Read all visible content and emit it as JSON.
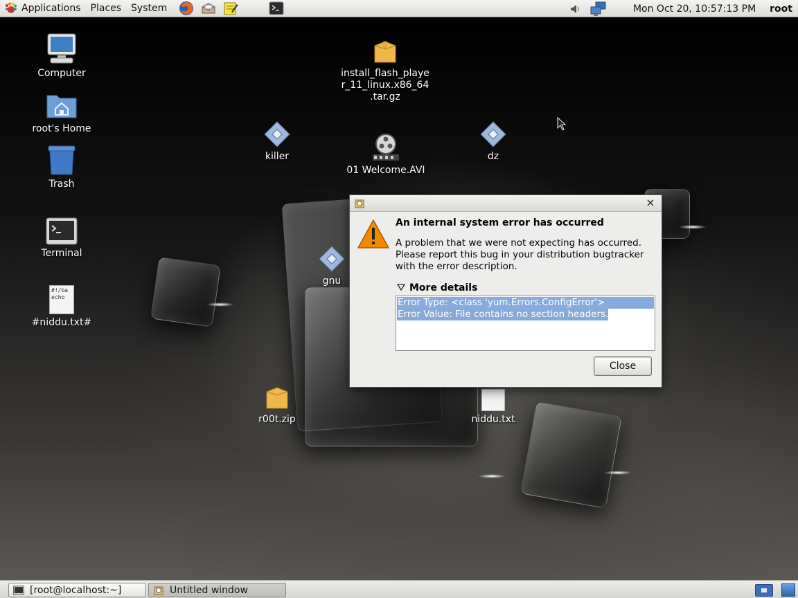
{
  "top_panel": {
    "menus": {
      "applications": "Applications",
      "places": "Places",
      "system": "System"
    },
    "clock": "Mon Oct 20, 10:57:13 PM",
    "user": "root"
  },
  "desktop_icons": {
    "computer": "Computer",
    "home": "root's Home",
    "trash": "Trash",
    "terminal": "Terminal",
    "niddu_backup": "#niddu.txt#",
    "flash_player": "install_flash_player_11_linux.x86_64.tar.gz",
    "killer": "killer",
    "welcome_video": "01 Welcome.AVI",
    "dz": "dz",
    "gnu": "gnu",
    "r00t_zip": "r00t.zip",
    "niddu_txt": "niddu.txt",
    "script_preview": [
      "#!/ba",
      "echo"
    ]
  },
  "dialog": {
    "heading": "An internal system error has occurred",
    "message": "A problem that we were not expecting has occurred. Please report this bug in your distribution bugtracker with the error description.",
    "details_label": "More details",
    "error_type": "Error Type: <class 'yum.Errors.ConfigError'>",
    "error_value": "Error Value: File contains no section headers.",
    "close_label": "Close"
  },
  "taskbar": {
    "tasks": [
      "[root@localhost:~]",
      "Untitled window"
    ]
  },
  "colors": {
    "selection": "#86abe0",
    "show_desktop": "#3a6fb8",
    "warning": "#f08a00"
  }
}
